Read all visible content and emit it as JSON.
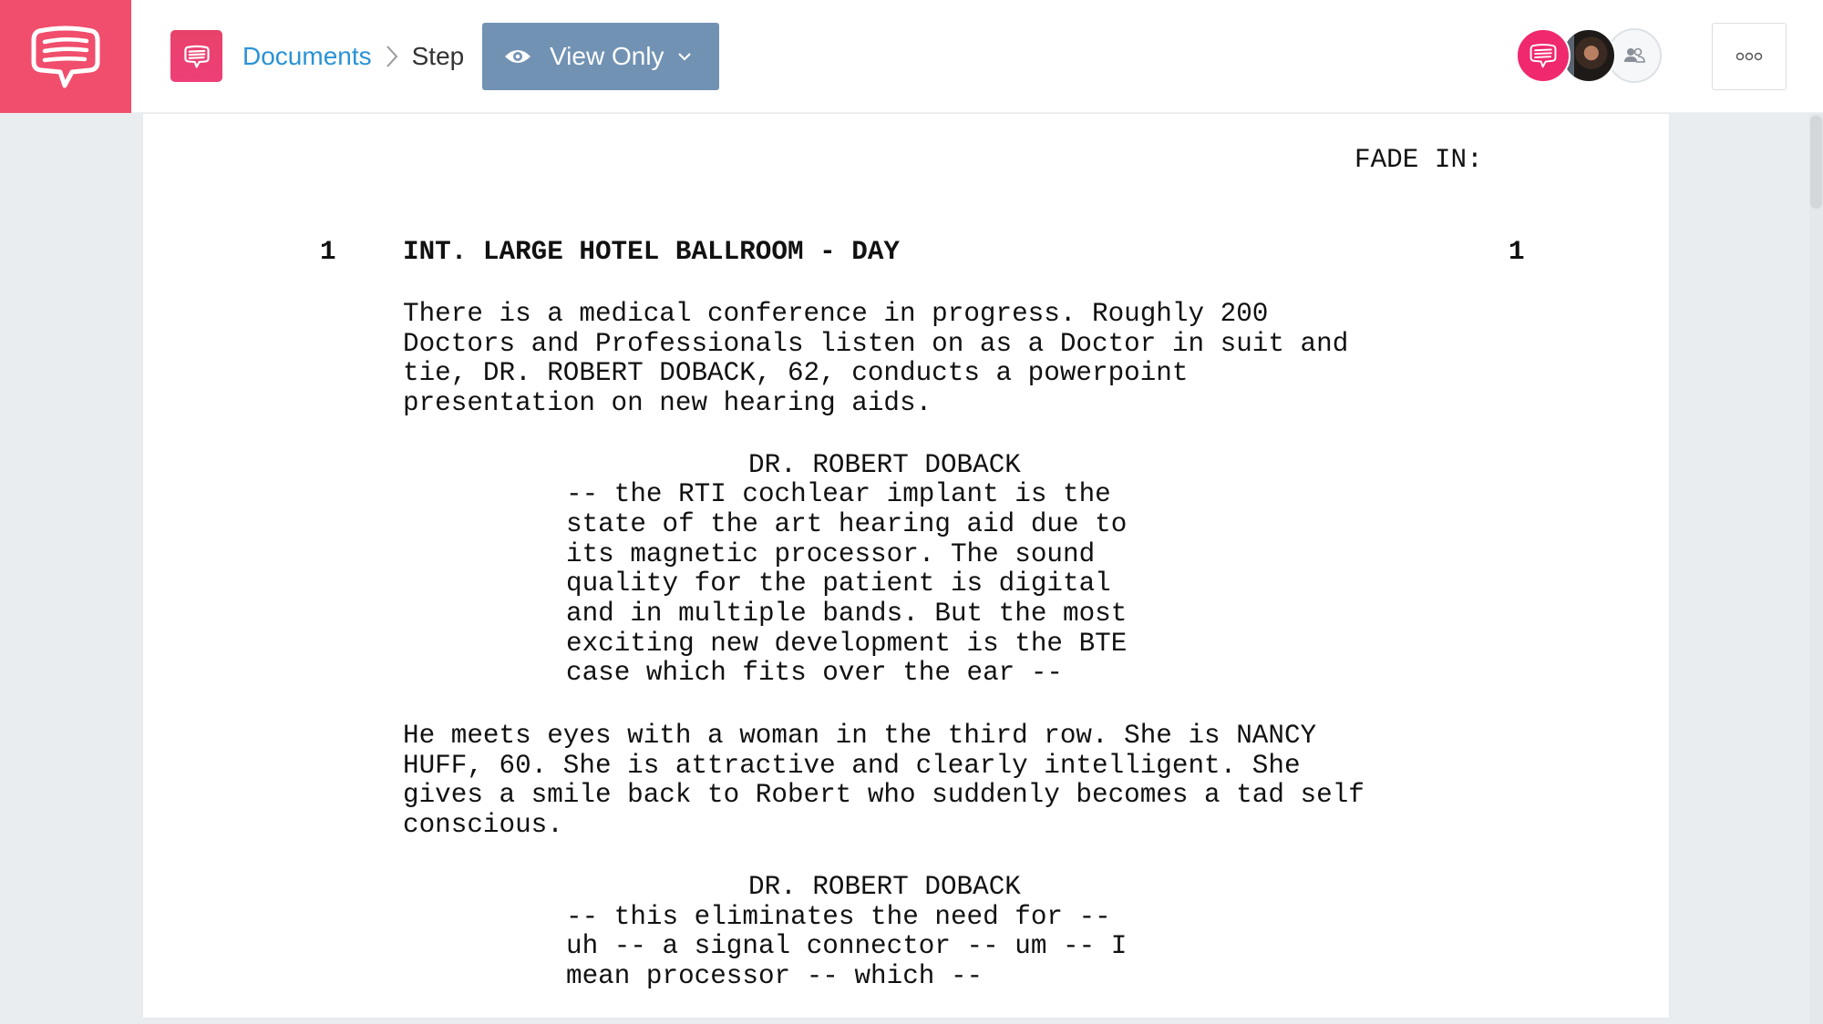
{
  "app": {
    "brand_color": "#f04e6c",
    "logo_icon": "speech-bubble-icon"
  },
  "header": {
    "doc_icon": "speech-bubble-icon",
    "breadcrumb": {
      "parent": "Documents",
      "separator_icon": "chevron-right-icon",
      "current": "Step"
    },
    "view_mode": {
      "icon": "eye-icon",
      "label": "View Only",
      "dropdown_icon": "chevron-down-icon",
      "color": "#7192b3"
    },
    "collaborators": [
      {
        "type": "app",
        "icon": "speech-bubble-icon",
        "color": "#f0286e"
      },
      {
        "type": "user-photo",
        "icon": "avatar-photo"
      },
      {
        "type": "share",
        "icon": "people-icon"
      }
    ],
    "more_menu": {
      "icon": "more-dots-icon"
    }
  },
  "script": {
    "transition": "FADE IN:",
    "scene": {
      "number_left": "1",
      "heading": "INT. LARGE HOTEL BALLROOM - DAY",
      "number_right": "1"
    },
    "action_1": [
      "There is a medical conference in progress. Roughly 200",
      "Doctors and Professionals listen on as a Doctor in suit and",
      "tie, DR. ROBERT DOBACK, 62, conducts a powerpoint",
      "presentation on new hearing aids."
    ],
    "dialogue_1": {
      "character": "DR. ROBERT DOBACK",
      "lines": [
        "-- the RTI cochlear implant is the",
        "state of the art hearing aid due to",
        "its magnetic processor. The sound",
        "quality for the patient is digital",
        "and in multiple bands. But the most",
        "exciting new development is the BTE",
        "case which fits over the ear --"
      ]
    },
    "action_2": [
      "He meets eyes with a woman in the third row. She is NANCY",
      "HUFF, 60. She is attractive and clearly intelligent. She",
      "gives a smile back to Robert who suddenly becomes a tad self",
      "conscious."
    ],
    "dialogue_2": {
      "character": "DR. ROBERT DOBACK",
      "lines": [
        "-- this eliminates the need for --",
        "uh -- a signal connector -- um -- I",
        "mean processor -- which --"
      ]
    }
  }
}
